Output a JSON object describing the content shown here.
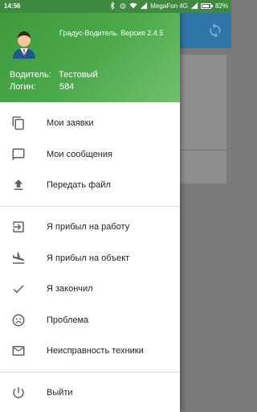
{
  "status_bar": {
    "time": "14:56",
    "carrier": "MegaFon 4G",
    "battery": "82%"
  },
  "drawer": {
    "header": {
      "app_version": "Градус-Водитель. Версия 2.4.5",
      "driver_label": "Водитель:",
      "driver_value": "Тестовый",
      "login_label": "Логин:",
      "login_value": "584"
    },
    "items": [
      {
        "label": "Мои заявки",
        "icon": "copy-icon"
      },
      {
        "label": "Мои сообщения",
        "icon": "chat-icon"
      },
      {
        "label": "Передать файл",
        "icon": "upload-icon"
      },
      {
        "label": "Я прибыл на работу",
        "icon": "login-icon"
      },
      {
        "label": "Я прибыл на объект",
        "icon": "flight-land-icon"
      },
      {
        "label": "Я закончил",
        "icon": "check-icon"
      },
      {
        "label": "Проблема",
        "icon": "sad-face-icon"
      },
      {
        "label": "Неисправность техники",
        "icon": "mail-icon"
      },
      {
        "label": "Выйти",
        "icon": "power-icon"
      }
    ]
  },
  "colors": {
    "drawer_header": "#4caa4c",
    "toolbar": "#2e76a8",
    "scrim": "#7a7a7a",
    "icon": "#616161"
  }
}
